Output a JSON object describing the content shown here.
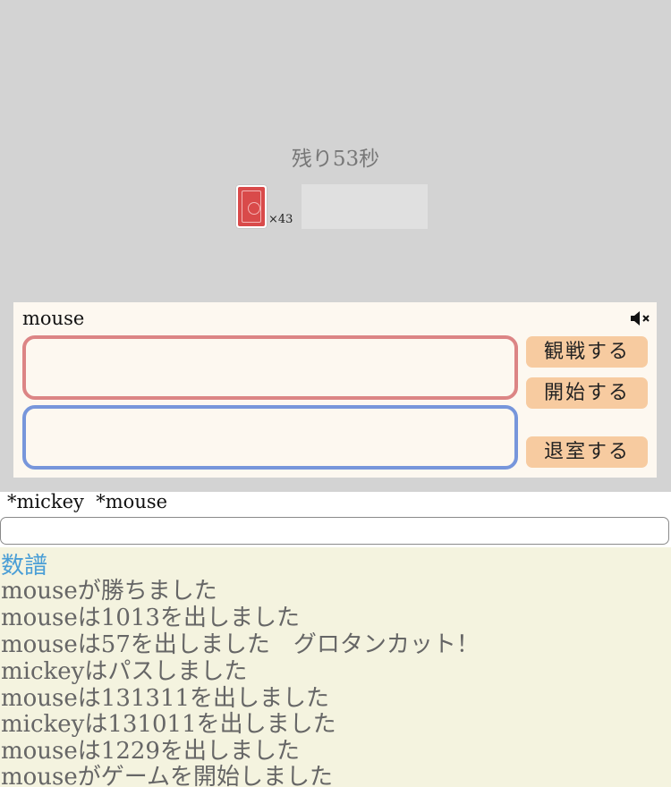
{
  "timer": "残り53秒",
  "deck": {
    "count": "×43"
  },
  "panel": {
    "player_name": "mouse",
    "mute_icon": "speaker-muted-icon",
    "buttons": {
      "spectate": "観戦する",
      "start": "開始する",
      "leave": "退室する"
    }
  },
  "players": "*mickey  *mouse",
  "chat": {
    "value": ""
  },
  "log": {
    "title": "数譜",
    "lines": [
      "mouseが勝ちました",
      "mouseは1013を出しました",
      "mouseは57を出しました　グロタンカット！",
      "mickeyはパスしました",
      "mouseは131311を出しました",
      "mickeyは131011を出しました",
      "mouseは1229を出しました",
      "mouseがゲームを開始しました"
    ]
  },
  "colors": {
    "board": "#d3d3d3",
    "card_back": "#d94a4a",
    "hand_red": "#dc8585",
    "hand_blue": "#7796db",
    "button": "#f7cba0",
    "log_bg": "#f4f3df",
    "log_title": "#4a9ed6"
  }
}
